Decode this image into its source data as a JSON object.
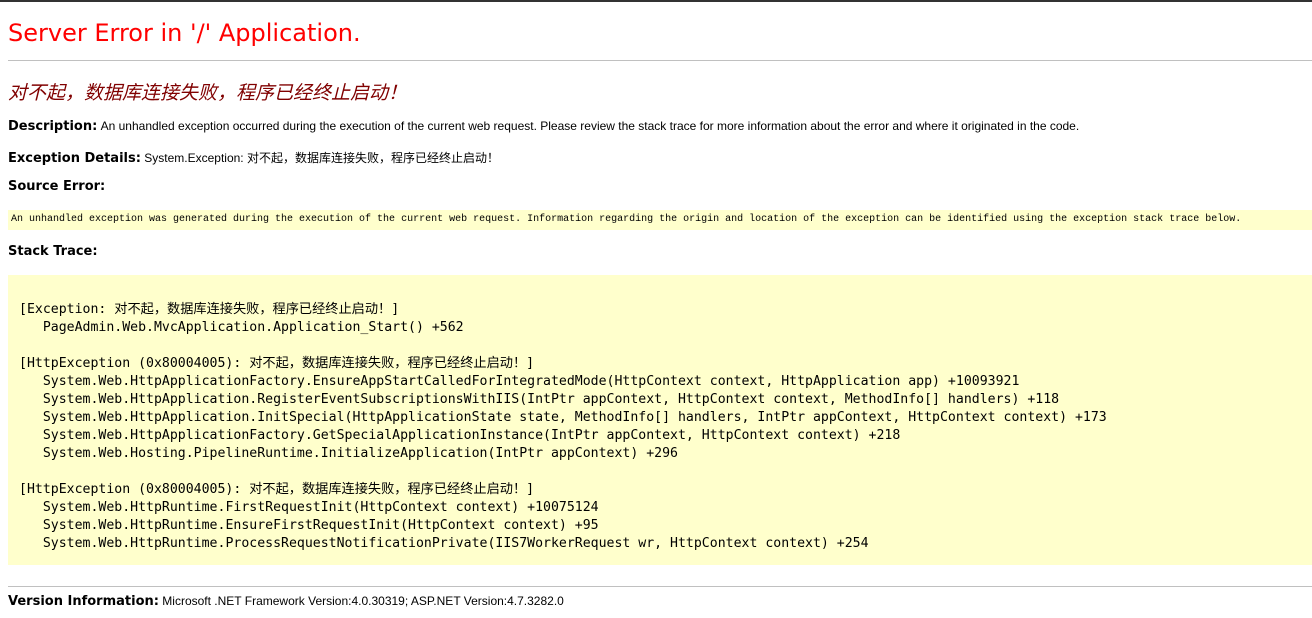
{
  "page": {
    "title": "Server Error in '/' Application.",
    "error_message": "对不起，数据库连接失败，程序已经终止启动！"
  },
  "description": {
    "label": "Description:",
    "text": "An unhandled exception occurred during the execution of the current web request. Please review the stack trace for more information about the error and where it originated in the code."
  },
  "exception_details": {
    "label": "Exception Details:",
    "text": "System.Exception: 对不起，数据库连接失败，程序已经终止启动！"
  },
  "source_error": {
    "label": "Source Error:",
    "text": "An unhandled exception was generated during the execution of the current web request. Information regarding the origin and location of the exception can be identified using the exception stack trace below."
  },
  "stack_trace": {
    "label": "Stack Trace:",
    "blocks": [
      {
        "header": "[Exception: 对不起，数据库连接失败，程序已经终止启动！]",
        "frames": [
          "PageAdmin.Web.MvcApplication.Application_Start() +562"
        ]
      },
      {
        "header": "[HttpException (0x80004005): 对不起，数据库连接失败，程序已经终止启动！]",
        "frames": [
          "System.Web.HttpApplicationFactory.EnsureAppStartCalledForIntegratedMode(HttpContext context, HttpApplication app) +10093921",
          "System.Web.HttpApplication.RegisterEventSubscriptionsWithIIS(IntPtr appContext, HttpContext context, MethodInfo[] handlers) +118",
          "System.Web.HttpApplication.InitSpecial(HttpApplicationState state, MethodInfo[] handlers, IntPtr appContext, HttpContext context) +173",
          "System.Web.HttpApplicationFactory.GetSpecialApplicationInstance(IntPtr appContext, HttpContext context) +218",
          "System.Web.Hosting.PipelineRuntime.InitializeApplication(IntPtr appContext) +296"
        ]
      },
      {
        "header": "[HttpException (0x80004005): 对不起，数据库连接失败，程序已经终止启动！]",
        "frames": [
          "System.Web.HttpRuntime.FirstRequestInit(HttpContext context) +10075124",
          "System.Web.HttpRuntime.EnsureFirstRequestInit(HttpContext context) +95",
          "System.Web.HttpRuntime.ProcessRequestNotificationPrivate(IIS7WorkerRequest wr, HttpContext context) +254"
        ]
      }
    ]
  },
  "version_information": {
    "label": "Version Information:",
    "text": "Microsoft .NET Framework Version:4.0.30319; ASP.NET Version:4.7.3282.0"
  },
  "colors": {
    "title": "#ff0000",
    "error_message": "#800000",
    "code_background": "#ffffcc",
    "rule": "#c0c0c0"
  }
}
